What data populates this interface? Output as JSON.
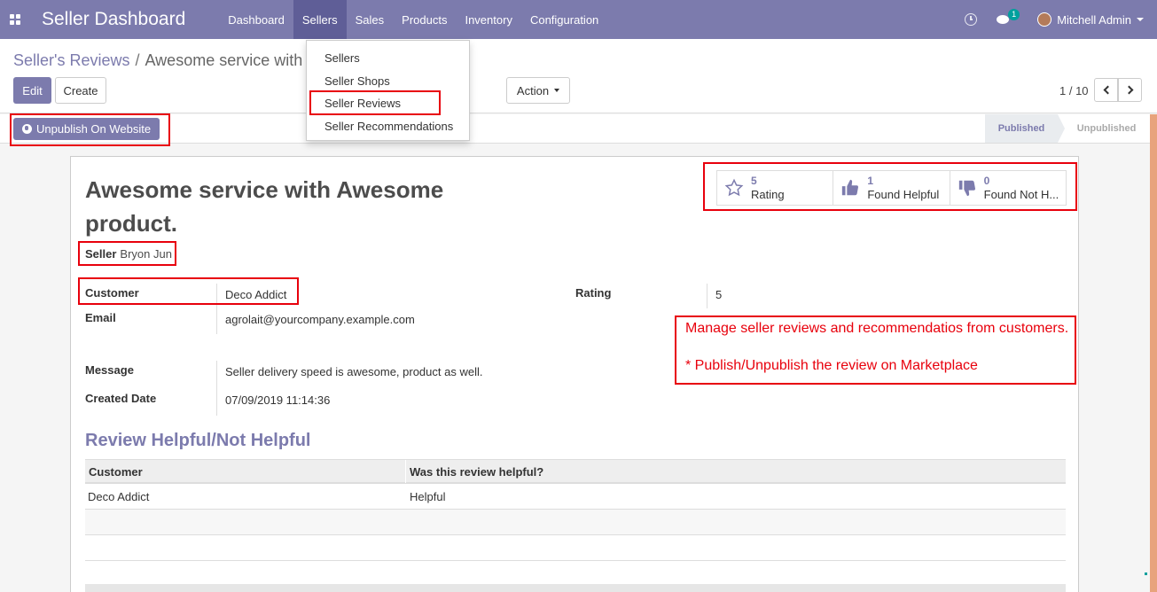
{
  "navbar": {
    "brand": "Seller Dashboard",
    "menu": [
      "Dashboard",
      "Sellers",
      "Sales",
      "Products",
      "Inventory",
      "Configuration"
    ],
    "active_menu": "Sellers",
    "chat_badge": "1",
    "user_name": "Mitchell Admin"
  },
  "breadcrumb": {
    "parent": "Seller's Reviews",
    "separator": "/",
    "current": "Awesome service with"
  },
  "buttons": {
    "edit": "Edit",
    "create": "Create",
    "action": "Action"
  },
  "pager": {
    "value": "1 / 10"
  },
  "dropdown": {
    "items": [
      "Sellers",
      "Seller Shops",
      "Seller Reviews",
      "Seller Recommendations"
    ]
  },
  "statusbar": {
    "unpublish_button": "Unpublish On Website",
    "stages": [
      "Published",
      "Unpublished"
    ],
    "active_stage": "Published"
  },
  "record": {
    "title": "Awesome service with Awesome product.",
    "seller_label": "Seller",
    "seller_value": "Bryon Jun",
    "customer_label": "Customer",
    "customer_value": "Deco Addict",
    "email_label": "Email",
    "email_value": "agrolait@yourcompany.example.com",
    "message_label": "Message",
    "message_value": "Seller delivery speed is awesome, product as well.",
    "created_label": "Created Date",
    "created_value": "07/09/2019 11:14:36",
    "rating_label": "Rating",
    "rating_value": "5"
  },
  "smart_buttons": [
    {
      "count": "5",
      "label": "Rating",
      "icon": "star-outline-icon"
    },
    {
      "count": "1",
      "label": "Found Helpful",
      "icon": "thumbs-up-icon"
    },
    {
      "count": "0",
      "label": "Found Not H...",
      "icon": "thumbs-down-icon"
    }
  ],
  "annotation": {
    "line1": "Manage seller reviews and recommendatios from customers.",
    "line2": "* Publish/Unpublish the review on Marketplace"
  },
  "helpful_section": {
    "title": "Review Helpful/Not Helpful",
    "columns": [
      "Customer",
      "Was this review helpful?"
    ],
    "rows": [
      {
        "customer": "Deco Addict",
        "helpful": "Helpful"
      }
    ]
  },
  "colors": {
    "primary": "#7c7bad",
    "annotation_red": "#e8000c",
    "accent_stripe": "#e8a37c"
  }
}
